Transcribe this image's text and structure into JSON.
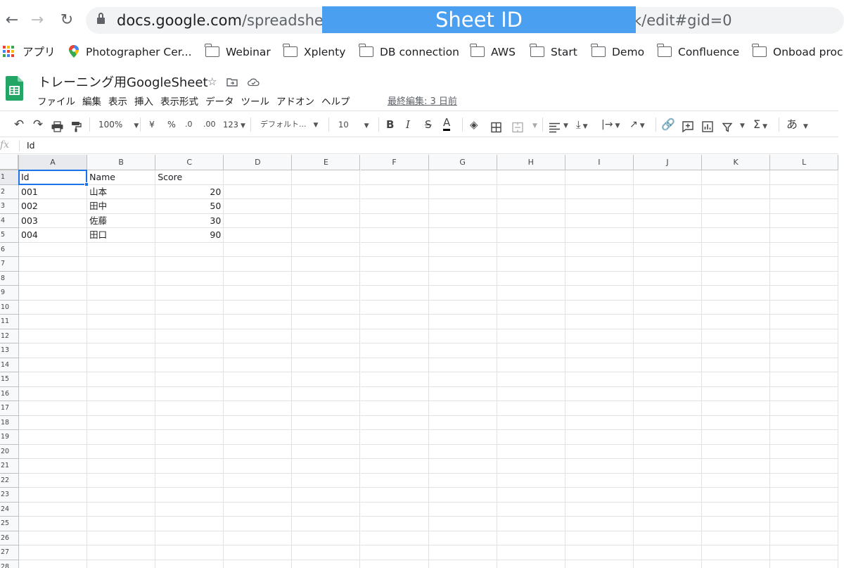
{
  "browser": {
    "url_domain": "docs.google.com",
    "url_path": "/spreadsheets/d/1",
    "url_tail": "k/edit#gid=0",
    "redaction_label": "Sheet ID",
    "redaction_color": "#4a9ff0"
  },
  "bookmarks": [
    {
      "label": "アプリ",
      "icon": "apps-grid-icon"
    },
    {
      "label": "Photographer Cer...",
      "icon": "maps-pin-icon"
    },
    {
      "label": "Webinar",
      "icon": "folder-icon"
    },
    {
      "label": "Xplenty",
      "icon": "folder-icon"
    },
    {
      "label": "DB connection",
      "icon": "folder-icon"
    },
    {
      "label": "AWS",
      "icon": "folder-icon"
    },
    {
      "label": "Start",
      "icon": "folder-icon"
    },
    {
      "label": "Demo",
      "icon": "folder-icon"
    },
    {
      "label": "Confluence",
      "icon": "folder-icon"
    },
    {
      "label": "Onboad proc",
      "icon": "folder-icon"
    }
  ],
  "doc": {
    "title": "トレーニング用GoogleSheet",
    "last_edit": "最終編集: 3 日前",
    "brand_color": "#23a566"
  },
  "menus": [
    "ファイル",
    "編集",
    "表示",
    "挿入",
    "表示形式",
    "データ",
    "ツール",
    "アドオン",
    "ヘルプ"
  ],
  "toolbar": {
    "zoom": "100%",
    "currency": "¥",
    "percent": "%",
    "dec_decrease": ".0",
    "dec_increase": ".00",
    "more_formats": "123",
    "font": "デフォルト...",
    "font_size": "10",
    "bold": "B",
    "italic": "I",
    "strike": "S",
    "text_color": "A",
    "input_tools": "あ"
  },
  "formula_bar": {
    "fx": "fx",
    "value": "Id"
  },
  "sheet": {
    "columns": [
      "A",
      "B",
      "C",
      "D",
      "E",
      "F",
      "G",
      "H",
      "I",
      "J",
      "K",
      "L"
    ],
    "row_numbers": [
      "1",
      "2",
      "3",
      "4",
      "5",
      "6",
      "7",
      "8",
      "9",
      "10",
      "11",
      "12",
      "13",
      "14",
      "15",
      "16",
      "17",
      "18",
      "19",
      "20",
      "21",
      "22",
      "23",
      "24",
      "25",
      "26",
      "27",
      "28"
    ],
    "active_cell": "A1",
    "rows": [
      [
        "Id",
        "Name",
        "Score"
      ],
      [
        "001",
        "山本",
        "20"
      ],
      [
        "002",
        "田中",
        "50"
      ],
      [
        "003",
        "佐藤",
        "30"
      ],
      [
        "004",
        "田口",
        "90"
      ]
    ]
  }
}
